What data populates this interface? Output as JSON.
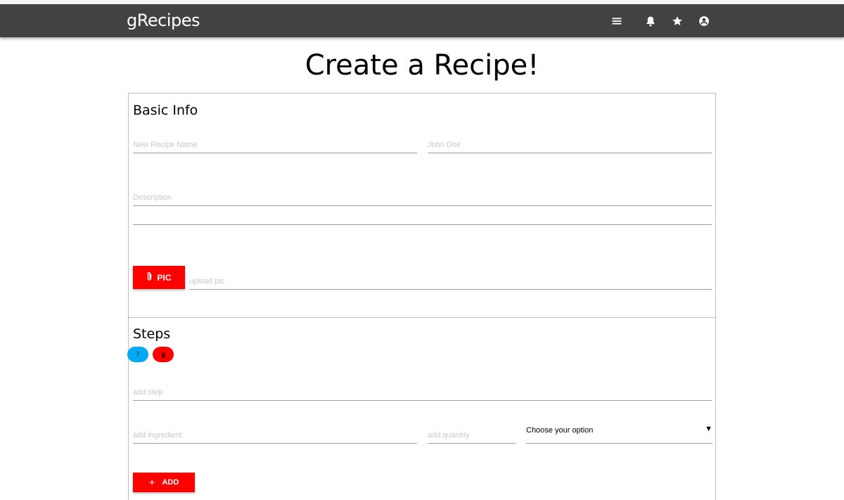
{
  "app": {
    "brand": "gRecipes"
  },
  "nav": {
    "icons": [
      "menu-icon",
      "notifications-icon",
      "star-icon",
      "account-icon"
    ]
  },
  "page": {
    "title": "Create a Recipe!"
  },
  "basic_info": {
    "title": "Basic Info",
    "recipe_name_placeholder": "New Recipe Name",
    "author_placeholder": "John Doe",
    "description_placeholder": "Description",
    "pic_button_label": "PIC",
    "upload_placeholder": "upload pic"
  },
  "steps": {
    "title": "Steps",
    "edit_pill_label": "7",
    "add_step_placeholder": "add step",
    "add_ingredient_placeholder": "add ingredient",
    "add_quantity_placeholder": "add quantity",
    "option_select_value": "Choose your option",
    "add_button_label": "ADD"
  },
  "colors": {
    "navbar": "#424242",
    "accent_red": "#ff0000",
    "accent_blue": "#03a9f4"
  }
}
